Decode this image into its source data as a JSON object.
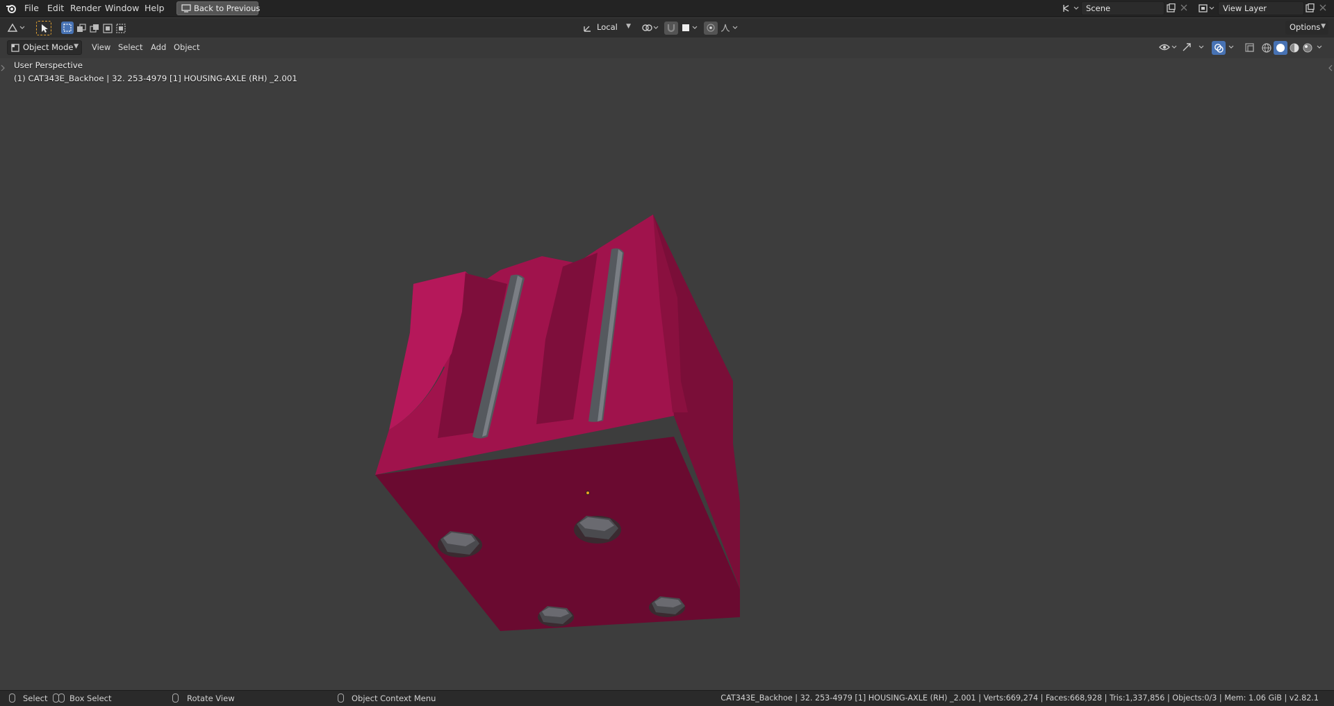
{
  "topbar": {
    "menu": [
      "File",
      "Edit",
      "Render",
      "Window",
      "Help"
    ],
    "back_button": "Back to Previous",
    "scene_value": "Scene",
    "view_layer_value": "View Layer"
  },
  "toolbar": {
    "orientation_value": "Local",
    "options_label": "Options"
  },
  "header": {
    "mode_value": "Object Mode",
    "menus": [
      "View",
      "Select",
      "Add",
      "Object"
    ]
  },
  "viewport": {
    "perspective_label": "User Perspective",
    "object_info": "(1) CAT343E_Backhoe | 32. 253-4979 [1] HOUSING-AXLE (RH) _2.001",
    "model_color": "#a0134c"
  },
  "statusbar": {
    "select_label": "Select",
    "box_select_label": "Box Select",
    "rotate_label": "Rotate View",
    "context_menu_label": "Object Context Menu",
    "stats": "CAT343E_Backhoe | 32. 253-4979 [1] HOUSING-AXLE (RH) _2.001 | Verts:669,274 | Faces:668,928 | Tris:1,337,856 | Objects:0/3 | Mem: 1.06 GiB | v2.82.1"
  }
}
